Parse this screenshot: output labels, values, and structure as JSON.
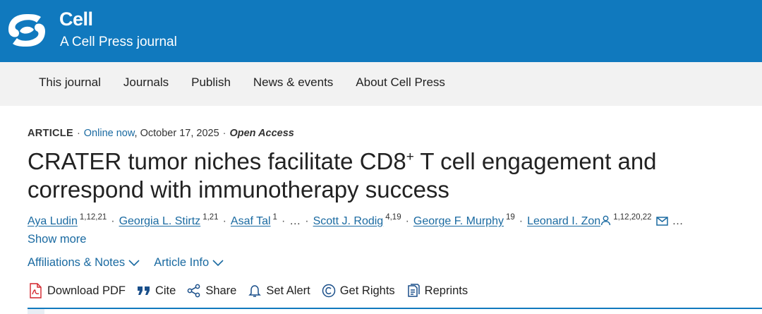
{
  "brand": {
    "name": "Cell",
    "subtitle": "A Cell Press journal",
    "color": "#1079be"
  },
  "nav": {
    "items": [
      "This journal",
      "Journals",
      "Publish",
      "News & events",
      "About Cell Press"
    ]
  },
  "article": {
    "type": "ARTICLE",
    "online_label": "Online now",
    "date": ", October 17, 2025",
    "access": "Open Access",
    "title_part1": "CRATER tumor niches facilitate CD8",
    "title_sup": "+",
    "title_part2": " T cell engagement and correspond with immunotherapy success"
  },
  "authors": [
    {
      "name": "Aya Ludin",
      "aff": "1,12,21"
    },
    {
      "name": "Georgia L. Stirtz",
      "aff": "1,21"
    },
    {
      "name": "Asaf Tal",
      "aff": "1"
    },
    {
      "name": "Scott J. Rodig",
      "aff": "4,19"
    },
    {
      "name": "George F. Murphy",
      "aff": "19"
    },
    {
      "name": "Leonard I. Zon",
      "aff": "1,12,20,22"
    }
  ],
  "authors_ellipsis": "…",
  "show_more": "Show more",
  "tabs": {
    "affiliations": "Affiliations & Notes",
    "article_info": "Article Info"
  },
  "tools": {
    "download_pdf": "Download PDF",
    "cite": "Cite",
    "share": "Share",
    "set_alert": "Set Alert",
    "get_rights": "Get Rights",
    "reprints": "Reprints"
  },
  "icons": {
    "logo": "cell-press-logo",
    "person": "person-icon",
    "mail": "mail-icon",
    "chevron": "chevron-down-icon",
    "pdf": "pdf-icon",
    "cite": "quote-icon",
    "share": "share-icon",
    "alert": "bell-icon",
    "rights": "copyright-icon",
    "reprints": "reprints-icon"
  },
  "colors": {
    "link": "#1a6aa1",
    "nav_bg": "#f2f2f2",
    "pdf_red": "#d2232a"
  }
}
